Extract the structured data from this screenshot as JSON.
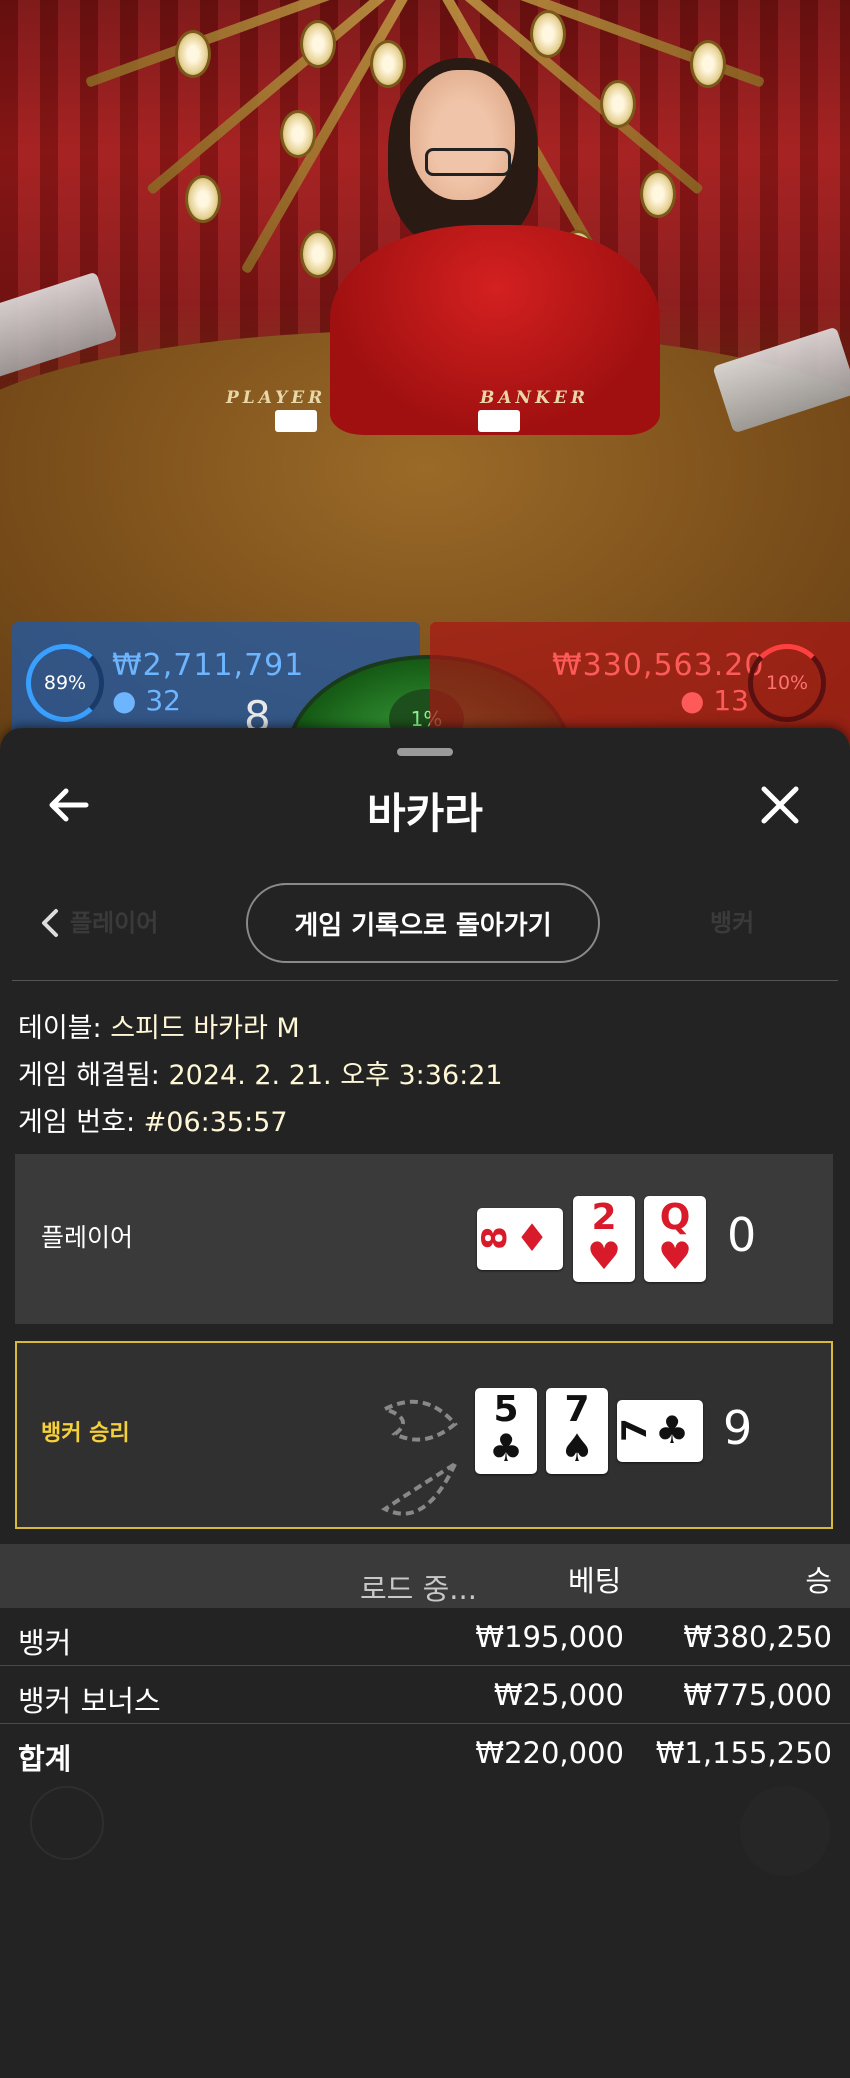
{
  "video": {
    "felt_player": "PLAYER",
    "felt_banker": "BANKER",
    "player_stats": {
      "percent": "89%",
      "amount": "₩2,711,791",
      "users": "32",
      "last_score": "8"
    },
    "banker_stats": {
      "percent": "10%",
      "amount": "₩330,563.20",
      "users": "13"
    },
    "tie_stats": {
      "percent": "1%"
    }
  },
  "sheet": {
    "title": "바카라",
    "back_icon": "arrow-left-icon",
    "close_icon": "close-icon",
    "prev_icon": "chevron-left-icon",
    "back_to_history_label": "게임 기록으로 돌아가기",
    "info": {
      "table_label": "테이블:",
      "table_value": "스피드 바카라 M",
      "resolved_label": "게임 해결됨:",
      "resolved_value": "2024. 2. 21. 오후 3:36:21",
      "game_no_label": "게임 번호:",
      "game_no_value": "#06:35:57"
    },
    "player_row": {
      "label": "플레이어",
      "score": "0",
      "cards": [
        {
          "rank": "8",
          "suit": "♦",
          "color": "red",
          "sideways": true
        },
        {
          "rank": "2",
          "suit": "♥",
          "color": "red",
          "sideways": false
        },
        {
          "rank": "Q",
          "suit": "♥",
          "color": "red",
          "sideways": false
        }
      ]
    },
    "banker_row": {
      "label": "뱅커 승리",
      "score": "9",
      "highlight_color": "#d8b93a",
      "cards": [
        {
          "rank": "5",
          "suit": "♣",
          "color": "black",
          "sideways": false
        },
        {
          "rank": "7",
          "suit": "♠",
          "color": "black",
          "sideways": false
        },
        {
          "rank": "7",
          "suit": "♣",
          "color": "black",
          "sideways": true
        }
      ]
    },
    "loading_text": "로드 중...",
    "bets": {
      "header_bet": "베팅",
      "header_win": "승",
      "rows": [
        {
          "name": "뱅커",
          "bet": "₩195,000",
          "win": "₩380,250"
        },
        {
          "name": "뱅커 보너스",
          "bet": "₩25,000",
          "win": "₩775,000"
        }
      ],
      "total": {
        "name": "합계",
        "bet": "₩220,000",
        "win": "₩1,155,250"
      }
    }
  }
}
